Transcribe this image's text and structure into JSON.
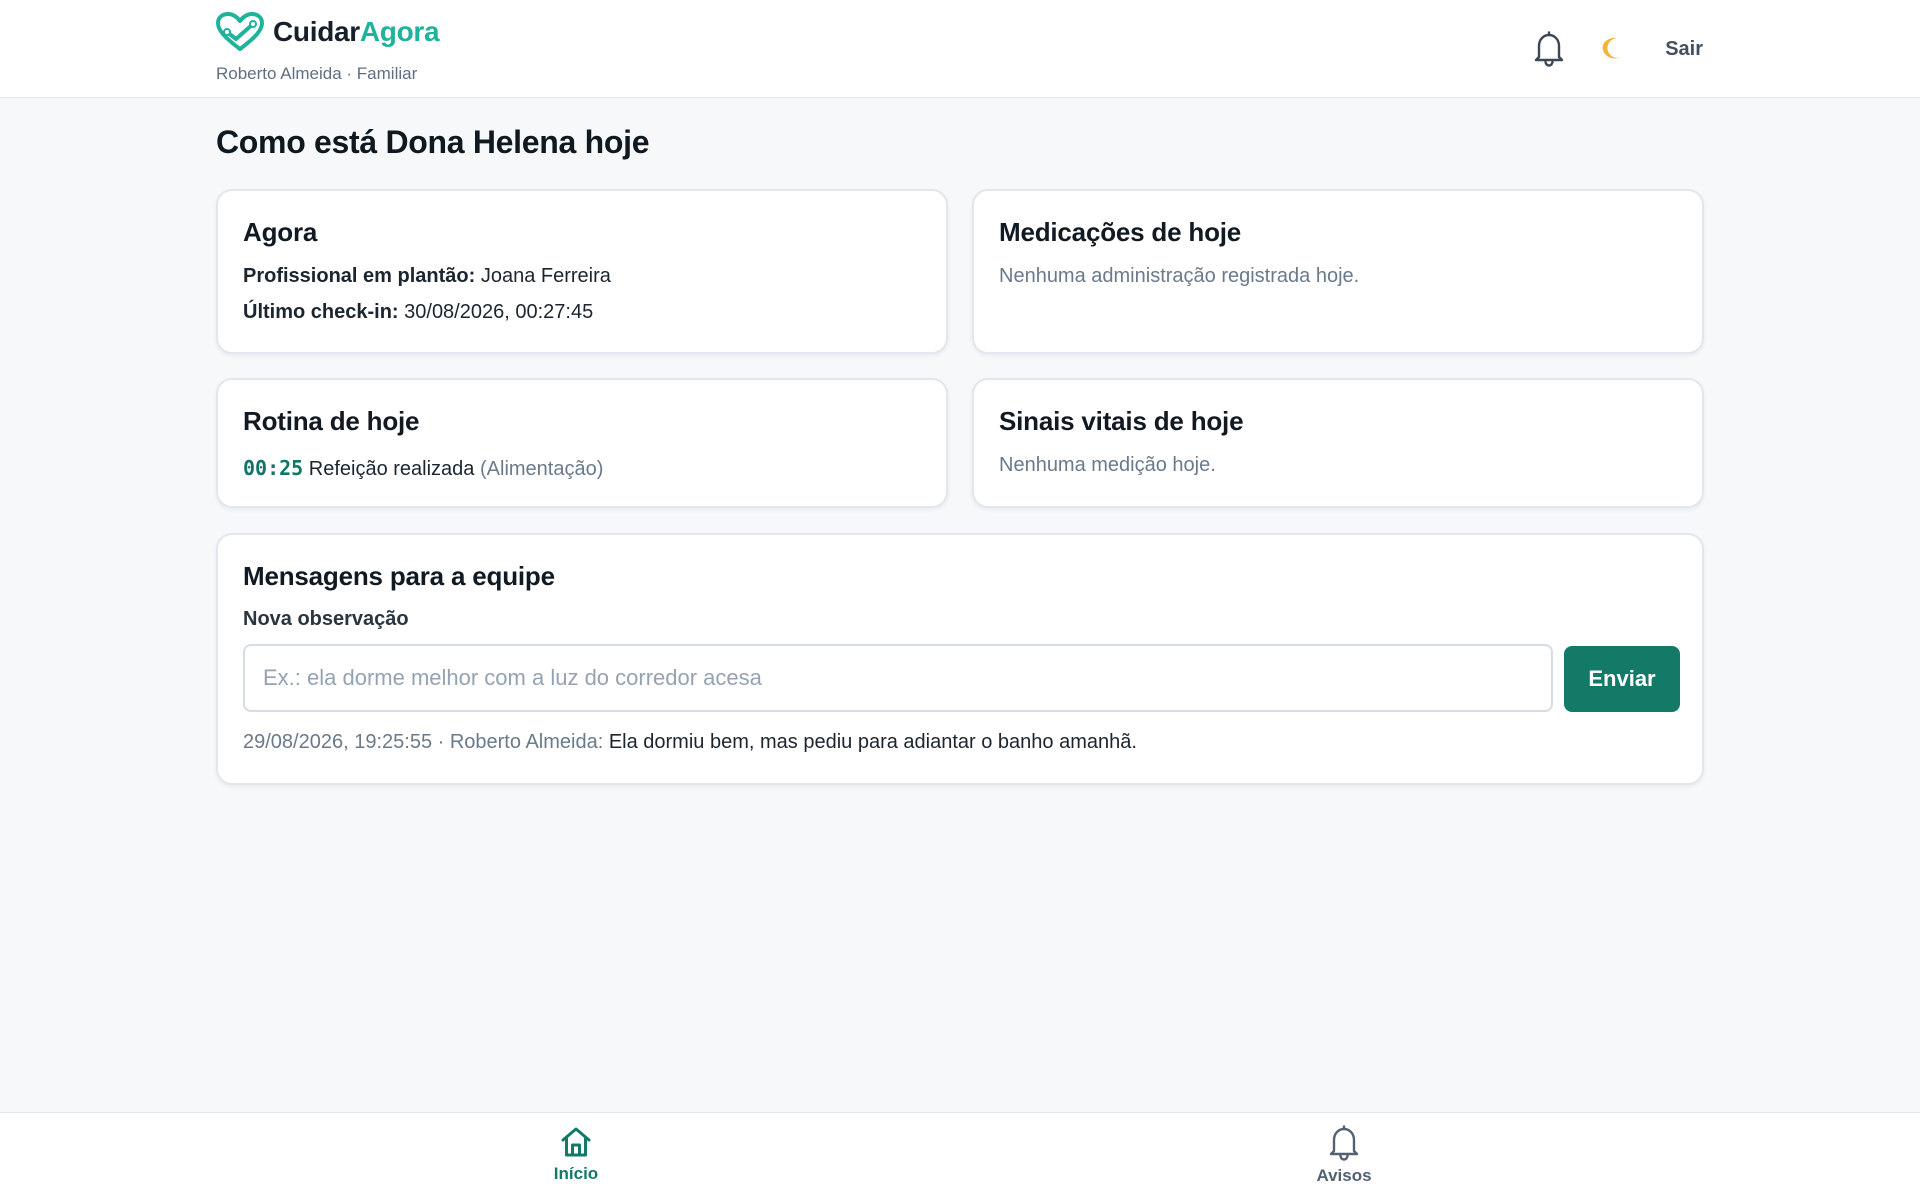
{
  "app": {
    "name_part1": "Cuidar",
    "name_part2": "Agora",
    "user_line": "Roberto Almeida · Familiar",
    "logout_label": "Sair",
    "accent_color": "#1fb39c",
    "primary_color": "#137a68"
  },
  "header": {
    "icons": [
      "bell-icon",
      "moon-icon"
    ]
  },
  "page": {
    "title": "Como está Dona Helena hoje"
  },
  "agora": {
    "title": "Agora",
    "duty_label": "Profissional em plantão:",
    "duty_value": " Joana Ferreira",
    "checkin_label": "Último check-in:",
    "checkin_value": " 30/08/2026, 00:27:45"
  },
  "meds": {
    "title": "Medicações de hoje",
    "empty": "Nenhuma administração registrada hoje."
  },
  "routine": {
    "title": "Rotina de hoje",
    "items": [
      {
        "time": "00:25",
        "text": " Refeição realizada ",
        "category": "(Alimentação)"
      }
    ]
  },
  "vitals": {
    "title": "Sinais vitais de hoje",
    "empty": "Nenhuma medição hoje."
  },
  "messages": {
    "title": "Mensagens para a equipe",
    "field_label": "Nova observação",
    "placeholder": "Ex.: ela dorme melhor com a luz do corredor acesa",
    "input_value": "",
    "send_label": "Enviar",
    "items": [
      {
        "meta": "29/08/2026, 19:25:55 · Roberto Almeida: ",
        "text": "Ela dormiu bem, mas pediu para adiantar o banho amanhã."
      }
    ]
  },
  "nav": {
    "items": [
      {
        "label": "Início",
        "icon": "home-icon",
        "active": true
      },
      {
        "label": "Avisos",
        "icon": "bell-icon",
        "active": false
      }
    ]
  }
}
